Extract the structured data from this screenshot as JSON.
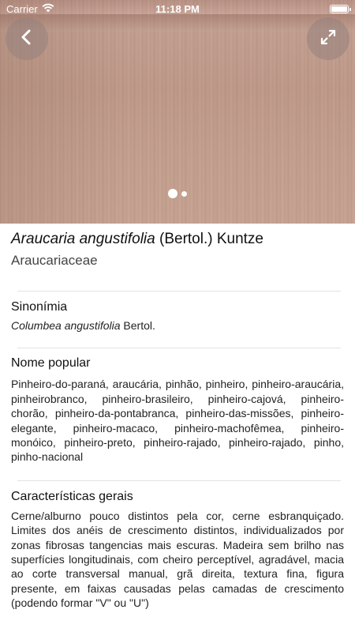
{
  "status_bar": {
    "carrier": "Carrier",
    "time": "11:18 PM",
    "text_color": "#ffffff"
  },
  "hero": {
    "icons": {
      "back": "chevron-left-icon",
      "expand": "expand-icon"
    },
    "pager": {
      "total": 2,
      "current": 1
    }
  },
  "species": {
    "genus_species": "Araucaria angustifolia",
    "author": " (Bertol.) Kuntze",
    "family": "Araucariaceae"
  },
  "sections": {
    "synonyms": {
      "title": "Sinonímia",
      "italic": "Columbea angustifolia",
      "author": " Bertol."
    },
    "popular_names": {
      "title": "Nome popular",
      "text": "Pinheiro-do-paraná, araucária, pinhão, pinheiro, pinheiro-araucária, pinheirobranco, pinheiro-brasileiro, pinheiro-cajová, pinheiro-chorão, pinheiro-da-pontabranca, pinheiro-das-missões, pinheiro-elegante, pinheiro-macaco, pinheiro-machofêmea, pinheiro-monóico, pinheiro-preto, pinheiro-rajado, pinheiro-rajado, pinho, pinho-nacional"
    },
    "general": {
      "title": "Características gerais",
      "text": "Cerne/alburno pouco distintos pela cor, cerne esbranquiçado. Limites dos anéis de crescimento distintos, individualizados por zonas fibrosas tangencias mais escuras. Madeira sem brilho nas superfícies longitudinais, com cheiro perceptível, agradável, macia ao corte transversal manual, grã direita, textura fina, figura presente, em faixas causadas pelas camadas de crescimento (podendo formar \"V\" ou \"U\")"
    }
  }
}
